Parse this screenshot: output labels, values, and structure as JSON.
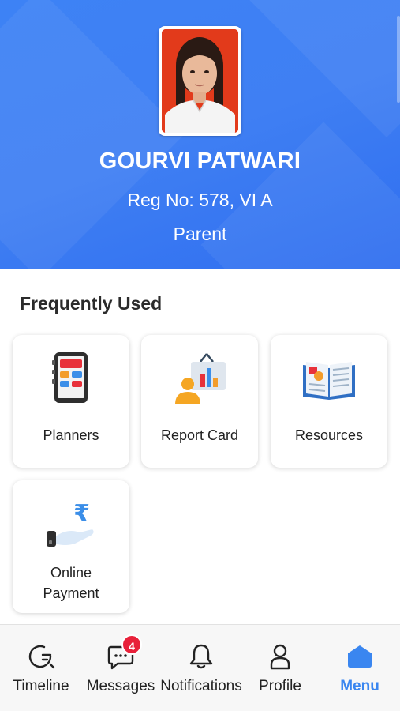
{
  "profile": {
    "name": "GOURVI PATWARI",
    "reg_no": "Reg No: 578, VI A",
    "role": "Parent",
    "header_color": "#3d82f5",
    "photo_background": "#e23a1b"
  },
  "frequently_used": {
    "title": "Frequently Used",
    "items": [
      {
        "label": "Planners",
        "icon": "planner-tablet-icon"
      },
      {
        "label": "Report Card",
        "icon": "report-card-icon"
      },
      {
        "label": "Resources",
        "icon": "open-book-icon"
      },
      {
        "label_line1": "Online",
        "label_line2": "Payment",
        "icon": "rupee-payment-icon"
      }
    ]
  },
  "bottom_nav": {
    "items": [
      {
        "label": "Timeline",
        "icon": "timeline-icon"
      },
      {
        "label": "Messages",
        "icon": "chat-bubble-icon",
        "badge": "4"
      },
      {
        "label": "Notifications",
        "icon": "bell-icon"
      },
      {
        "label": "Profile",
        "icon": "person-icon"
      },
      {
        "label": "Menu",
        "icon": "home-icon",
        "active": true
      }
    ],
    "active_color": "#3a86f0",
    "badge_color": "#e8213a"
  }
}
